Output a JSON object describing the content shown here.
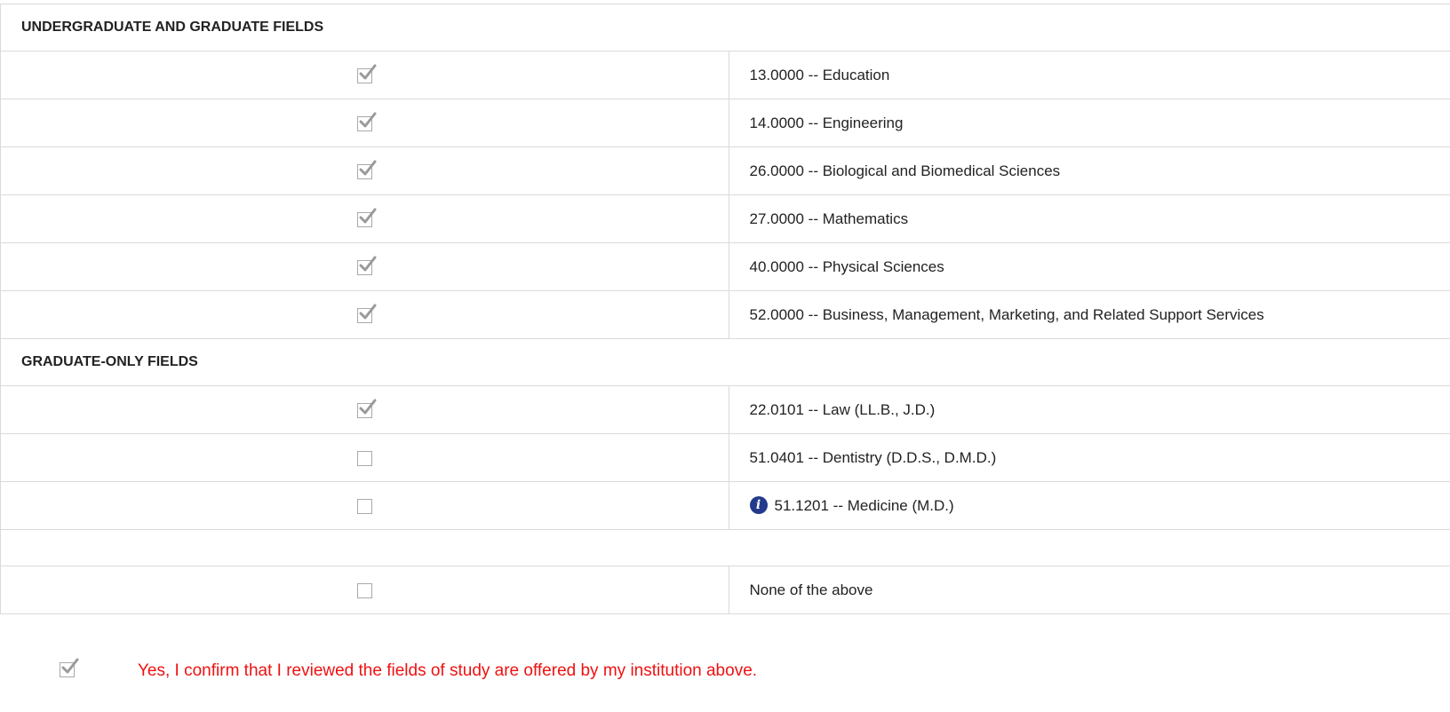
{
  "sections": [
    {
      "title": "UNDERGRADUATE AND GRADUATE FIELDS",
      "rows": [
        {
          "label": "13.0000 -- Education",
          "checked": true,
          "info": false
        },
        {
          "label": "14.0000 -- Engineering",
          "checked": true,
          "info": false
        },
        {
          "label": "26.0000 -- Biological and Biomedical Sciences",
          "checked": true,
          "info": false
        },
        {
          "label": "27.0000 -- Mathematics",
          "checked": true,
          "info": false
        },
        {
          "label": "40.0000 -- Physical Sciences",
          "checked": true,
          "info": false
        },
        {
          "label": "52.0000 -- Business, Management, Marketing, and Related Support Services",
          "checked": true,
          "info": false
        }
      ]
    },
    {
      "title": "GRADUATE-ONLY FIELDS",
      "rows": [
        {
          "label": "22.0101 -- Law (LL.B., J.D.)",
          "checked": true,
          "info": false
        },
        {
          "label": "51.0401 -- Dentistry (D.D.S., D.M.D.)",
          "checked": false,
          "info": false
        },
        {
          "label": "51.1201 -- Medicine (M.D.)",
          "checked": false,
          "info": true
        }
      ]
    }
  ],
  "none_option": {
    "label": "None of the above",
    "checked": false
  },
  "confirmation": {
    "label": "Yes, I confirm that I reviewed the fields of study are offered by my institution above.",
    "checked": true
  },
  "icons": {
    "info": "i"
  },
  "colors": {
    "check_mark": "#9a9a9a",
    "confirmation_text": "#ee1111",
    "info_icon": "#233a8c",
    "border": "#dadada"
  }
}
